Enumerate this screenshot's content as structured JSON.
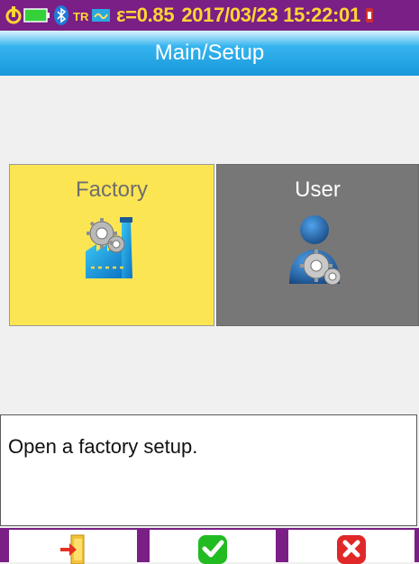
{
  "status_bar": {
    "emissivity": "ε=0.85",
    "datetime": "2017/03/23 15:22:01",
    "icons": [
      "power-plug-icon",
      "battery-icon",
      "bluetooth-icon",
      "tr-icon",
      "storage-icon",
      "alarm-icon"
    ],
    "background_color": "#7a1f86",
    "text_color": "#ffd633"
  },
  "title_bar": {
    "title": "Main/Setup"
  },
  "tiles": [
    {
      "label": "Factory",
      "icon": "factory-gears-icon",
      "selected": true,
      "color": "#fce553"
    },
    {
      "label": "User",
      "icon": "user-gears-icon",
      "selected": false,
      "color": "#777777"
    }
  ],
  "description": {
    "text": "Open a factory setup."
  },
  "bottom_bar": {
    "buttons": [
      {
        "icon": "exit-door-icon"
      },
      {
        "icon": "check-icon",
        "color": "#22bb22"
      },
      {
        "icon": "cancel-x-icon",
        "color": "#e02828"
      }
    ]
  }
}
